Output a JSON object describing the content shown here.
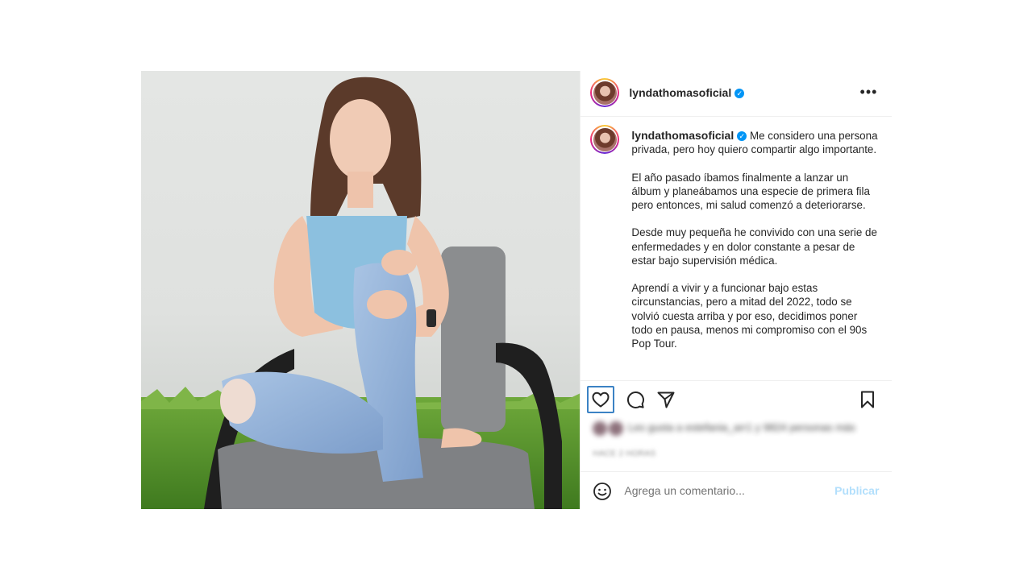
{
  "post": {
    "username": "lyndathomasoficial",
    "verified_glyph": "✓",
    "more_label": "•••",
    "caption_paragraphs": [
      "Me considero una persona privada, pero hoy quiero compartir algo importante.",
      "El año pasado íbamos finalmente a lanzar un álbum y planeábamos una especie de primera fila pero entonces, mi salud comenzó a deteriorarse.",
      "Desde muy pequeña he convivido con una serie de enfermedades y en dolor constante a pesar de estar bajo supervisión médica.",
      "Aprendí a vivir y a funcionar bajo estas circunstancias, pero a mitad del 2022, todo se volvió cuesta arriba y por eso, decidimos poner todo en pausa, menos mi compromiso con el 90s Pop Tour."
    ],
    "actions": {
      "like_icon": "heart-icon",
      "comment_icon": "comment-icon",
      "share_icon": "paper-plane-icon",
      "save_icon": "bookmark-icon"
    },
    "likes_text_blurred": "Les gusta a estefania_arr1 y 9824 personas más",
    "date_blurred": "HACE 2 HORAS",
    "comment": {
      "placeholder": "Agrega un comentario...",
      "emoji_icon": "smiley-icon",
      "publish_label": "Publicar"
    },
    "colors": {
      "accent": "#0095f6",
      "publish_disabled": "#b2dffc",
      "focus_ring": "#3b82c4"
    }
  }
}
